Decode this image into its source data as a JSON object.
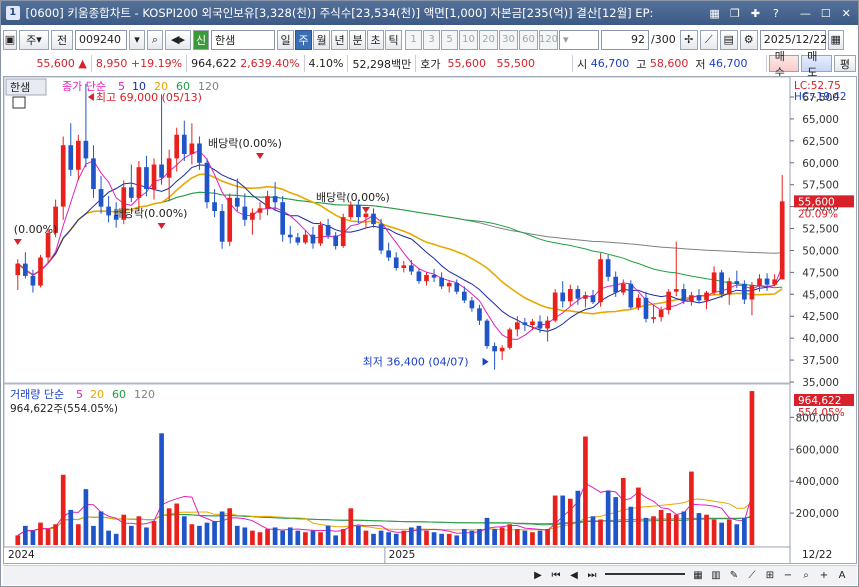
{
  "window": {
    "title": "[0600] 키움종합차트 - KOSPI200 외국인보유[3,328(천)] 주식수[23,534(천)] 액면[1,000] 자본금[235(억)] 결산[12월] EP:",
    "icon": "1"
  },
  "toolbar": {
    "type_label": "주",
    "prev_label": "전",
    "code": "009240",
    "name": "한샘",
    "name_badge": "신",
    "periods": [
      "일",
      "주",
      "월",
      "년",
      "분",
      "초",
      "틱"
    ],
    "selected_period": "주",
    "numbers": [
      "1",
      "3",
      "5",
      "10",
      "20",
      "30",
      "60",
      "120"
    ],
    "count": "92",
    "count_total": "/300",
    "date": "2025/12/22"
  },
  "quote": {
    "price": "55,600",
    "change": "8,950",
    "pct": "+19.19%",
    "volume": "964,622",
    "vol_pct": "2,639.40%",
    "turnover": "4.10%",
    "amount": "52,298백만",
    "hoga_label": "호가",
    "ask": "55,600",
    "bid": "55,500",
    "open_label": "시",
    "open": "46,700",
    "high_label": "고",
    "high": "58,600",
    "low_label": "저",
    "low": "46,700",
    "buy": "매수",
    "sell": "매도",
    "eval": "평"
  },
  "price_panel": {
    "tab": "한샘",
    "legend": "종가 단순",
    "ma_periods": [
      "5",
      "10",
      "20",
      "60",
      "120"
    ],
    "lc": "LC:52.75",
    "hc": "HC:-19.42",
    "high_note": "최고 69,000 (05/13)",
    "low_note": "최저 36,400 (04/07)",
    "div_notes": [
      "(0.00%)",
      "배당락(0.00%)",
      "배당락(0.00%)",
      "배당락(0.00%)"
    ],
    "last_price": "55,600",
    "last_pct": "20.09%",
    "y_ticks": [
      "67,500",
      "65,000",
      "62,500",
      "60,000",
      "57,500",
      "55,000",
      "52,500",
      "50,000",
      "47,500",
      "45,000",
      "42,500",
      "40,000",
      "37,500",
      "35,000"
    ]
  },
  "volume_panel": {
    "legend": "거래량 단순",
    "ma_periods": [
      "5",
      "20",
      "60",
      "120"
    ],
    "info": "964,622주(554.05%)",
    "last_volume": "964,622",
    "last_pct": "554.05%",
    "y_ticks": [
      "800,000",
      "600,000",
      "400,000",
      "200,000"
    ]
  },
  "x_axis": {
    "labels": [
      "2024",
      "2025"
    ],
    "end_label": "12/22"
  },
  "colors": {
    "up": "#e8211d",
    "down": "#1f55c8",
    "ma5": "#e020c0",
    "ma10": "#1a2aa0",
    "ma20": "#e8a800",
    "ma60": "#20a040",
    "ma120": "#808080"
  },
  "chart_data": {
    "type": "candlestick",
    "x_range": [
      "2024-01",
      "2025-12-22"
    ],
    "ylim": [
      35000,
      67500
    ],
    "candles": [
      [
        47200,
        49000,
        45500,
        48500
      ],
      [
        48500,
        49800,
        46800,
        47100
      ],
      [
        47100,
        47800,
        45200,
        46000
      ],
      [
        46000,
        49500,
        45800,
        49200
      ],
      [
        49200,
        52500,
        48600,
        52000
      ],
      [
        52000,
        55800,
        51500,
        55000
      ],
      [
        55000,
        63000,
        53500,
        62000
      ],
      [
        62000,
        64500,
        58500,
        59200
      ],
      [
        59200,
        63200,
        58000,
        62500
      ],
      [
        62500,
        69000,
        59500,
        60500
      ],
      [
        60500,
        62000,
        56000,
        57000
      ],
      [
        57000,
        58500,
        54200,
        55000
      ],
      [
        55000,
        56200,
        53200,
        54000
      ],
      [
        54000,
        55500,
        52600,
        53500
      ],
      [
        53500,
        58000,
        53000,
        57200
      ],
      [
        57200,
        59800,
        55500,
        56000
      ],
      [
        56000,
        60200,
        54500,
        59500
      ],
      [
        59500,
        60800,
        56200,
        57000
      ],
      [
        57000,
        60500,
        55800,
        59800
      ],
      [
        59800,
        67800,
        57500,
        58300
      ],
      [
        58300,
        61500,
        55600,
        60500
      ],
      [
        60500,
        64000,
        59000,
        63200
      ],
      [
        63200,
        64800,
        60200,
        61000
      ],
      [
        61000,
        64500,
        59800,
        62200
      ],
      [
        62200,
        63000,
        59200,
        60000
      ],
      [
        60000,
        60500,
        54800,
        55500
      ],
      [
        55500,
        57000,
        53800,
        54500
      ],
      [
        54500,
        55300,
        50200,
        51000
      ],
      [
        51000,
        56500,
        50500,
        56000
      ],
      [
        56000,
        58200,
        54500,
        55000
      ],
      [
        55000,
        56500,
        52800,
        53500
      ],
      [
        53500,
        54800,
        51800,
        54300
      ],
      [
        54300,
        55500,
        53500,
        54800
      ],
      [
        54800,
        56800,
        54000,
        56200
      ],
      [
        56200,
        57800,
        54500,
        55500
      ],
      [
        55500,
        56200,
        51000,
        51800
      ],
      [
        51800,
        52800,
        50800,
        51500
      ],
      [
        51500,
        52000,
        50600,
        50900
      ],
      [
        50900,
        52300,
        50700,
        51800
      ],
      [
        51800,
        52700,
        50200,
        50800
      ],
      [
        50800,
        53300,
        50500,
        52900
      ],
      [
        52900,
        53600,
        51300,
        51700
      ],
      [
        51700,
        52100,
        50100,
        50500
      ],
      [
        50500,
        54200,
        50300,
        53800
      ],
      [
        53800,
        55600,
        53500,
        55200
      ],
      [
        55200,
        55800,
        53100,
        53800
      ],
      [
        53800,
        54600,
        52500,
        54200
      ],
      [
        54200,
        54800,
        52600,
        53000
      ],
      [
        53000,
        53600,
        49600,
        50000
      ],
      [
        50000,
        50900,
        48800,
        49200
      ],
      [
        49200,
        49800,
        47700,
        48000
      ],
      [
        48000,
        48800,
        47500,
        48300
      ],
      [
        48300,
        48900,
        47200,
        47600
      ],
      [
        47600,
        47900,
        46200,
        46500
      ],
      [
        46500,
        47500,
        46000,
        47200
      ],
      [
        47200,
        47900,
        46400,
        46900
      ],
      [
        46900,
        47500,
        45600,
        45900
      ],
      [
        45900,
        46600,
        45200,
        46300
      ],
      [
        46300,
        46700,
        45000,
        45300
      ],
      [
        45300,
        45900,
        44000,
        44300
      ],
      [
        44300,
        44700,
        43000,
        43400
      ],
      [
        43400,
        43800,
        41500,
        42000
      ],
      [
        42000,
        42200,
        38800,
        39100
      ],
      [
        39100,
        39500,
        36400,
        38500
      ],
      [
        38500,
        39200,
        37500,
        38900
      ],
      [
        38900,
        41200,
        38700,
        41000
      ],
      [
        41000,
        42500,
        40200,
        41800
      ],
      [
        41800,
        42300,
        40800,
        41500
      ],
      [
        41500,
        42200,
        40900,
        41900
      ],
      [
        41900,
        42600,
        40600,
        41100
      ],
      [
        41100,
        42500,
        39600,
        42000
      ],
      [
        42000,
        45600,
        41800,
        45200
      ],
      [
        45200,
        46500,
        43500,
        44200
      ],
      [
        44200,
        46100,
        43700,
        45600
      ],
      [
        45600,
        46000,
        43800,
        44500
      ],
      [
        44500,
        45300,
        43500,
        44900
      ],
      [
        44900,
        45500,
        43900,
        44100
      ],
      [
        44100,
        49700,
        43600,
        49000
      ],
      [
        49000,
        49500,
        46500,
        47000
      ],
      [
        47000,
        47600,
        44700,
        45200
      ],
      [
        45200,
        46700,
        44900,
        46200
      ],
      [
        46200,
        46600,
        43300,
        43500
      ],
      [
        43500,
        45000,
        43200,
        44600
      ],
      [
        44600,
        45300,
        41800,
        42200
      ],
      [
        42200,
        43800,
        41700,
        42400
      ],
      [
        42400,
        43600,
        41900,
        43200
      ],
      [
        43200,
        45600,
        42700,
        45300
      ],
      [
        45300,
        51000,
        44800,
        45600
      ],
      [
        45600,
        46200,
        43900,
        44200
      ],
      [
        44200,
        45300,
        43700,
        44900
      ],
      [
        44900,
        45600,
        44000,
        44300
      ],
      [
        44300,
        45400,
        43300,
        45200
      ],
      [
        45200,
        48200,
        44900,
        47500
      ],
      [
        47500,
        47800,
        44600,
        45000
      ],
      [
        45000,
        46900,
        43800,
        46500
      ],
      [
        46500,
        47700,
        45700,
        46200
      ],
      [
        46200,
        46600,
        43900,
        44400
      ],
      [
        44400,
        46400,
        42600,
        46000
      ],
      [
        46000,
        47300,
        45300,
        46800
      ],
      [
        46800,
        47400,
        45400,
        46100
      ],
      [
        46100,
        47300,
        45900,
        46700
      ],
      [
        46700,
        58600,
        46700,
        55600
      ]
    ],
    "volumes": [
      60000,
      120000,
      90000,
      140000,
      100000,
      130000,
      440000,
      220000,
      130000,
      350000,
      120000,
      210000,
      90000,
      70000,
      190000,
      120000,
      180000,
      110000,
      150000,
      700000,
      230000,
      260000,
      180000,
      130000,
      120000,
      140000,
      150000,
      210000,
      230000,
      120000,
      110000,
      90000,
      80000,
      100000,
      110000,
      90000,
      110000,
      90000,
      80000,
      90000,
      80000,
      120000,
      60000,
      100000,
      230000,
      120000,
      90000,
      70000,
      90000,
      80000,
      70000,
      90000,
      110000,
      120000,
      90000,
      80000,
      70000,
      70000,
      60000,
      100000,
      90000,
      100000,
      170000,
      100000,
      110000,
      130000,
      100000,
      90000,
      80000,
      90000,
      100000,
      310000,
      310000,
      290000,
      340000,
      680000,
      180000,
      160000,
      340000,
      300000,
      420000,
      240000,
      360000,
      170000,
      180000,
      220000,
      200000,
      190000,
      210000,
      460000,
      200000,
      190000,
      160000,
      140000,
      160000,
      130000,
      170000,
      964622
    ]
  }
}
